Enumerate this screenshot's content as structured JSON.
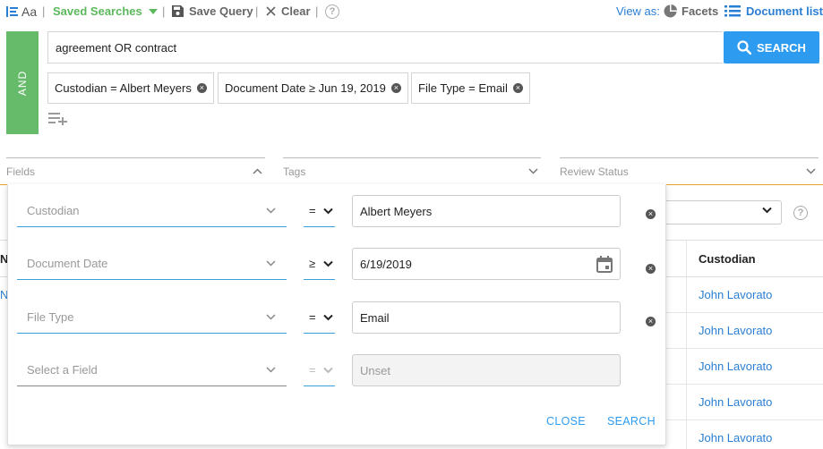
{
  "toolbar": {
    "case_label": "Aa",
    "saved_searches": "Saved Searches",
    "save_query": "Save Query",
    "clear": "Clear",
    "help": "?",
    "view_as": "View as:",
    "facets": "Facets",
    "document_list": "Document list",
    "separator": "|"
  },
  "query": {
    "operator": "AND",
    "text": "agreement OR contract",
    "search_button": "SEARCH",
    "chips": [
      {
        "label": "Custodian = Albert Meyers"
      },
      {
        "label": "Document Date ≥ Jun 19, 2019"
      },
      {
        "label": "File Type = Email"
      }
    ]
  },
  "facets": [
    {
      "label": "Fields"
    },
    {
      "label": "Tags"
    },
    {
      "label": "Review Status"
    }
  ],
  "table": {
    "header_custodian": "Custodian",
    "header_left_fragment": "N",
    "row_left_fragment": "N",
    "rows": [
      {
        "custodian": "John Lavorato"
      },
      {
        "custodian": "John Lavorato"
      },
      {
        "custodian": "John Lavorato"
      },
      {
        "custodian": "John Lavorato"
      },
      {
        "custodian": "John Lavorato"
      }
    ],
    "help": "?"
  },
  "field_panel": {
    "rows": [
      {
        "field": "Custodian",
        "operator": "=",
        "value": "Albert Meyers"
      },
      {
        "field": "Document Date",
        "operator": "≥",
        "value": "6/19/2019"
      },
      {
        "field": "File Type",
        "operator": "=",
        "value": "Email"
      },
      {
        "field": "Select a Field",
        "operator": "=",
        "value": "Unset"
      }
    ],
    "close_button": "CLOSE",
    "search_button": "SEARCH"
  },
  "colors": {
    "accent_blue": "#2d9bf0",
    "link_blue": "#2a7fd4",
    "and_green": "#66bb6a",
    "saved_green": "#5cb85c",
    "underline_blue": "#3aa0d8",
    "orange": "#f0a030"
  }
}
